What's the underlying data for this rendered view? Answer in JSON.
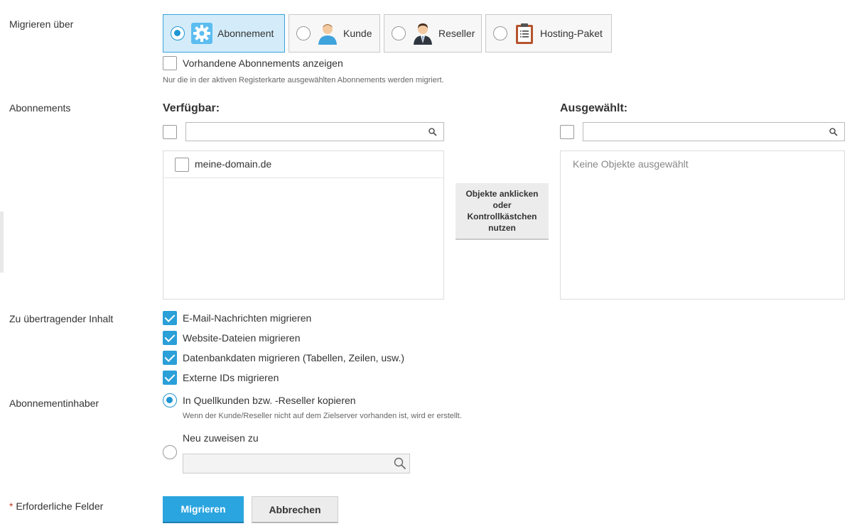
{
  "labels": {
    "migrate_via": "Migrieren über",
    "subscriptions": "Abonnements",
    "content": "Zu übertragender Inhalt",
    "owner": "Abonnementinhaber",
    "required_star": "*",
    "required": "Erforderliche Felder"
  },
  "migrate_options": [
    {
      "label": "Abonnement",
      "icon": "gear-icon",
      "selected": true
    },
    {
      "label": "Kunde",
      "icon": "customer-icon",
      "selected": false
    },
    {
      "label": "Reseller",
      "icon": "reseller-icon",
      "selected": false
    },
    {
      "label": "Hosting-Paket",
      "icon": "clipboard-icon",
      "selected": false
    }
  ],
  "show_existing": {
    "label": "Vorhandene Abonnements anzeigen",
    "checked": false
  },
  "show_existing_hint": "Nur die in der aktiven Registerkarte ausgewählten Abonnements werden migriert.",
  "available": {
    "title": "Verfügbar:",
    "search_value": "",
    "items": [
      {
        "label": "meine-domain.de",
        "checked": false
      }
    ]
  },
  "selected": {
    "title": "Ausgewählt:",
    "search_value": "",
    "empty_text": "Keine Objekte ausgewählt"
  },
  "move_hint": "Objekte anklicken oder Kontrollkästchen nutzen",
  "content_options": [
    {
      "label": "E-Mail-Nachrichten migrieren",
      "checked": true
    },
    {
      "label": "Website-Dateien migrieren",
      "checked": true
    },
    {
      "label": "Datenbankdaten migrieren (Tabellen, Zeilen, usw.)",
      "checked": true
    },
    {
      "label": "Externe IDs migrieren",
      "checked": true
    }
  ],
  "owner": {
    "copy_label": "In Quellkunden bzw. -Reseller kopieren",
    "copy_hint": "Wenn der Kunde/Reseller nicht auf dem Zielserver vorhanden ist, wird er erstellt.",
    "reassign_label": "Neu zuweisen zu",
    "reassign_value": "",
    "selected": "copy"
  },
  "buttons": {
    "migrate": "Migrieren",
    "cancel": "Abbrechen"
  },
  "colors": {
    "accent": "#2ba5df",
    "tile_active_bg": "#d4ecfa",
    "required_star": "#c0392b"
  }
}
